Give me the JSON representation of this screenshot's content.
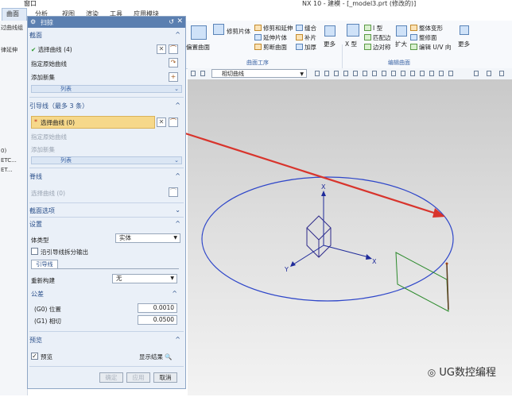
{
  "app": {
    "title": "NX 10 - 建模 - [_model3.prt (修改的)]",
    "window_menu": "窗口"
  },
  "ribbon_tabs": [
    "曲面",
    "分析",
    "视图",
    "渲染",
    "工具",
    "应用模块"
  ],
  "ribbon": {
    "left_partial": [
      "过曲线组",
      "律延伸"
    ],
    "trim_big": "修剪片体",
    "trim_items": [
      "修剪和延伸",
      "延伸片体",
      "剪断曲面"
    ],
    "ops_items": [
      "缝合",
      "补片",
      "加厚"
    ],
    "more": "更多",
    "offset_label": "偏置曲面",
    "xshape": "X 型",
    "i_items": [
      "I 型",
      "匹配边",
      "边对称"
    ],
    "expand": "扩大",
    "shape_items": [
      "整体变形",
      "整修面",
      "编辑 U/V 向"
    ],
    "group_surface_ops": "曲面工序",
    "group_edit_surface": "编辑曲面"
  },
  "toolbar2": {
    "curve_filter": "相切曲线"
  },
  "left_strip": [
    "曲面",
    "过曲线组",
    "律延伸",
    "0)",
    "ETC...",
    "ET..."
  ],
  "dialog": {
    "title": "扫掠",
    "section": {
      "title": "截面",
      "select_curve": "选择曲线 (4)",
      "origin_curve": "指定原始曲线",
      "add_new": "添加新集",
      "list": "列表"
    },
    "guide": {
      "title": "引导线（最多 3 条）",
      "select_curve": "选择曲线 (0)",
      "origin_curve": "指定原始曲线",
      "add_new": "添加新集",
      "list": "列表"
    },
    "spine": {
      "title": "脊线",
      "select_curve": "选择曲线 (0)"
    },
    "section_options": {
      "title": "截面选项"
    },
    "settings": {
      "title": "设置",
      "body_type_label": "体类型",
      "body_type_value": "实体",
      "split_output_label": "沿引导线拆分输出",
      "subtab": "引导线",
      "rebuild_label": "重新构建",
      "rebuild_value": "无",
      "tolerance_title": "公差",
      "g0_label": "(G0) 位置",
      "g0_value": "0.0010",
      "g1_label": "(G1) 相切",
      "g1_value": "0.0500"
    },
    "preview": {
      "title": "预览",
      "preview_label": "预览",
      "show_result": "显示结果"
    },
    "buttons": {
      "ok": "确定",
      "apply": "应用",
      "cancel": "取消"
    }
  },
  "axes": {
    "x": "X",
    "y": "Y",
    "z": "X"
  },
  "watermark": "UG数控编程"
}
